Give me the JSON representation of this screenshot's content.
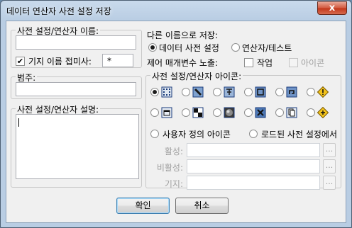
{
  "window": {
    "title": "데이터 연산자 사전 설정 저장",
    "close_label": "x"
  },
  "name_group": {
    "label": "사전 설정/연산자 이름:",
    "name_value": "",
    "prefix_checkbox_label": "기지 이름 접미사:",
    "prefix_checked": true,
    "prefix_value": "*"
  },
  "category_group": {
    "label": "범주:",
    "value": ""
  },
  "description_group": {
    "label": "사전 설정/연산자 설명:",
    "value": ""
  },
  "save_as": {
    "label": "다른 이름으로 저장:",
    "options": [
      "데이터 사전 설정",
      "연산자/테스트"
    ],
    "selected_index": 0
  },
  "expose": {
    "label": "제어 매개변수 노출:",
    "options": [
      {
        "label": "작업",
        "checked": false,
        "enabled": true
      },
      {
        "label": "아이콘",
        "checked": false,
        "enabled": false
      }
    ]
  },
  "icon_group": {
    "label": "사전 설정/연산자 아이콘:",
    "row1": [
      "grid-dots-icon",
      "brush-icon",
      "tree-icon",
      "frame-icon",
      "loop-icon",
      "warning-diamond-icon"
    ],
    "row2": [
      "window-icon",
      "checker-icon",
      "sphere-icon",
      "x-box-icon",
      "copy-icon",
      "compass-diamond-icon"
    ],
    "selected_icon": "grid-dots-icon",
    "source_options": [
      "사용자 정의 아이콘",
      "로드된 사전 설정에서"
    ],
    "fields": [
      {
        "label": "활성:",
        "value": ""
      },
      {
        "label": "비활성:",
        "value": ""
      },
      {
        "label": "기지:",
        "value": ""
      }
    ],
    "browse_label": "..."
  },
  "buttons": {
    "ok": "확인",
    "cancel": "취소"
  }
}
